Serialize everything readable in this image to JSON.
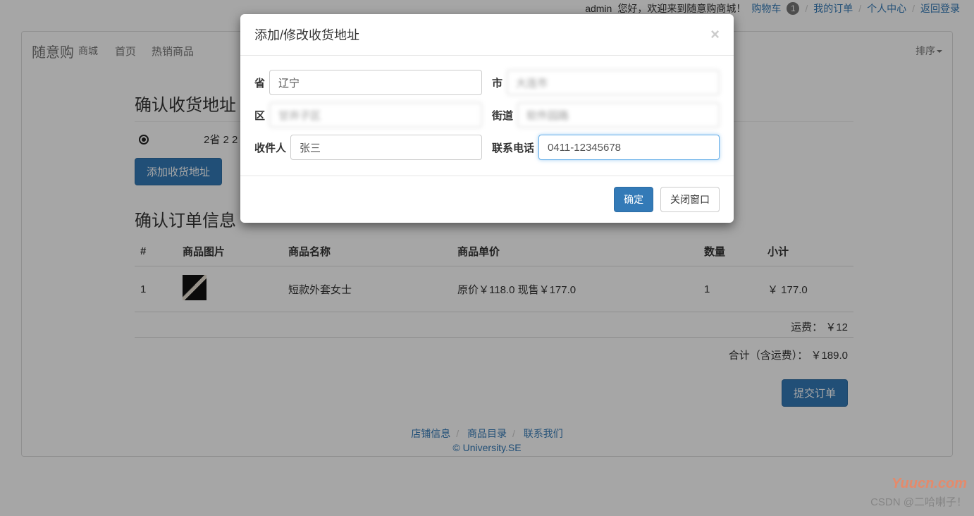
{
  "topbar": {
    "greeting_user": "admin",
    "greeting_text": "您好，欢迎来到随意购商城！",
    "cart": "购物车",
    "cart_count": "1",
    "orders": "我的订单",
    "center": "个人中心",
    "logout": "返回登录"
  },
  "nav": {
    "brand": "随意购",
    "brand_sub": "商城",
    "home": "首页",
    "hot": "热销商品",
    "sort": "排序"
  },
  "address": {
    "section_title": "确认收货地址",
    "option_label": "2省 2 2",
    "add_button": "添加收货地址"
  },
  "order": {
    "section_title": "确认订单信息",
    "headers": {
      "idx": "#",
      "img": "商品图片",
      "name": "商品名称",
      "price": "商品单价",
      "qty": "数量",
      "sub": "小计"
    },
    "rows": [
      {
        "idx": "1",
        "name": "短款外套女士",
        "price": "原价￥118.0   现售￥177.0",
        "qty": "1",
        "sub": "￥ 177.0"
      }
    ],
    "shipping_label": "运费：",
    "shipping_value": "￥12",
    "total_label": "合计（含运费）：",
    "total_value": "￥189.0",
    "submit": "提交订单"
  },
  "footer": {
    "a": "店铺信息",
    "b": "商品目录",
    "c": "联系我们",
    "copy": "© University.SE"
  },
  "modal": {
    "title": "添加/修改收货地址",
    "labels": {
      "province": "省",
      "city": "市",
      "district": "区",
      "street": "街道",
      "receiver": "收件人",
      "phone": "联系电话"
    },
    "values": {
      "province": "辽宁",
      "city": "大连市",
      "district": "甘井子区",
      "street": "软件园路",
      "receiver": "张三",
      "phone": "0411-12345678"
    },
    "confirm": "确定",
    "close": "关闭窗口"
  },
  "watermark": {
    "logo": "Yuucn.com",
    "credit": "CSDN @二哈喇子！"
  }
}
